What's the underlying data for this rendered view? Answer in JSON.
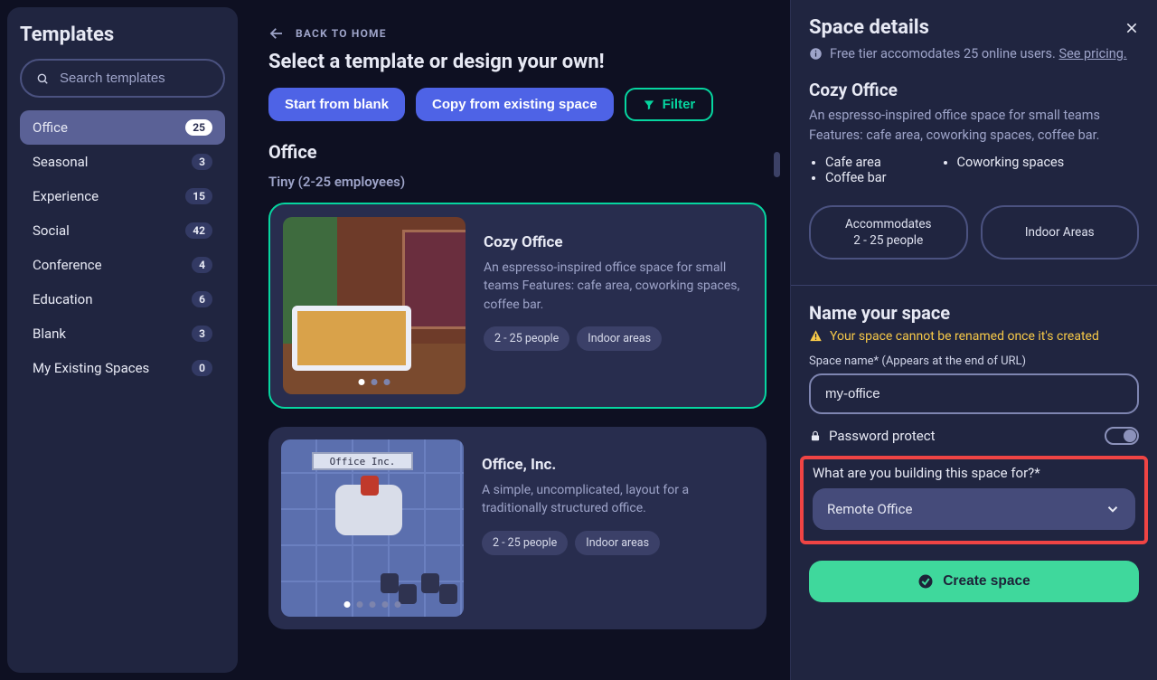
{
  "sidebar": {
    "title": "Templates",
    "search_placeholder": "Search templates",
    "categories": [
      {
        "label": "Office",
        "count": "25",
        "active": true
      },
      {
        "label": "Seasonal",
        "count": "3"
      },
      {
        "label": "Experience",
        "count": "15"
      },
      {
        "label": "Social",
        "count": "42"
      },
      {
        "label": "Conference",
        "count": "4"
      },
      {
        "label": "Education",
        "count": "6"
      },
      {
        "label": "Blank",
        "count": "3"
      },
      {
        "label": "My Existing Spaces",
        "count": "0"
      }
    ]
  },
  "main": {
    "back": "BACK TO HOME",
    "heading": "Select a template or design your own!",
    "buttons": {
      "blank": "Start from blank",
      "copy": "Copy from existing space",
      "filter": "Filter"
    },
    "section": "Office",
    "subsection": "Tiny (2-25 employees)",
    "cards": [
      {
        "title": "Cozy Office",
        "desc": "An espresso-inspired office space for small teams Features: cafe area, coworking spaces, coffee bar.",
        "chip1": "2 - 25 people",
        "chip2": "Indoor areas",
        "dots": 3,
        "selected": true
      },
      {
        "title": "Office, Inc.",
        "plate": "Office Inc.",
        "desc": "A simple, uncomplicated, layout for a traditionally structured office.",
        "chip1": "2 - 25 people",
        "chip2": "Indoor areas",
        "dots": 5
      }
    ]
  },
  "panel": {
    "title": "Space details",
    "tier_prefix": "Free tier accomodates 25 online users. ",
    "tier_link": "See pricing.",
    "template_title": "Cozy Office",
    "template_desc": "An espresso-inspired office space for small teams Features: cafe area, coworking spaces, coffee bar.",
    "features_left": [
      "Cafe area",
      "Coffee bar"
    ],
    "features_right": [
      "Coworking spaces"
    ],
    "pill1_line1": "Accommodates",
    "pill1_line2": "2 - 25 people",
    "pill2": "Indoor Areas",
    "name_heading": "Name your space",
    "name_warning": "Your space cannot be renamed once it's created",
    "name_label": "Space name* (Appears at the end of URL)",
    "name_value": "my-office",
    "password_label": "Password protect",
    "purpose_label": "What are you building this space for?*",
    "purpose_value": "Remote Office",
    "create": "Create space"
  }
}
